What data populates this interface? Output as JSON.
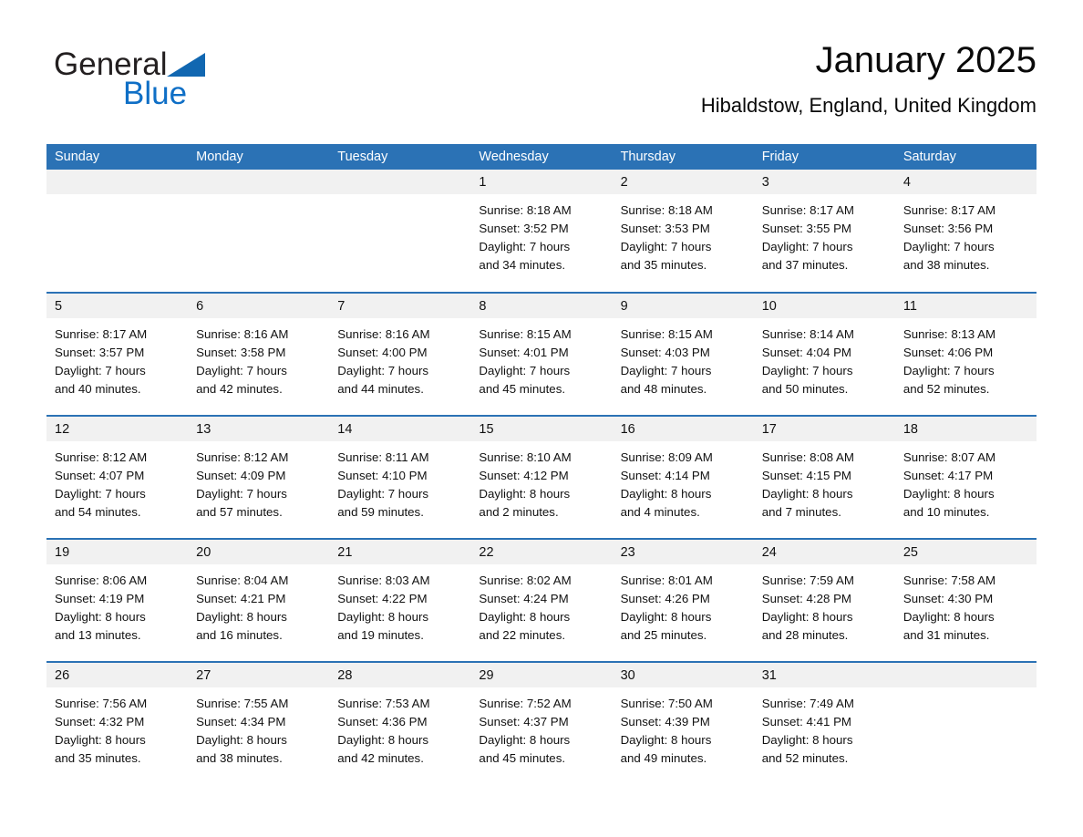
{
  "brand": {
    "name_part1": "General",
    "name_part2": "Blue",
    "flag_icon": "triangle-flag-icon",
    "accent_color": "#0f6fc6"
  },
  "header": {
    "title": "January 2025",
    "location": "Hibaldstow, England, United Kingdom"
  },
  "theme": {
    "header_blue": "#2b72b5",
    "daynum_gray": "#f1f1f1",
    "rule_blue": "#2b72b5"
  },
  "calendar": {
    "weekday_headers": [
      "Sunday",
      "Monday",
      "Tuesday",
      "Wednesday",
      "Thursday",
      "Friday",
      "Saturday"
    ],
    "weeks": [
      [
        {
          "day": "",
          "lines": []
        },
        {
          "day": "",
          "lines": []
        },
        {
          "day": "",
          "lines": []
        },
        {
          "day": "1",
          "lines": [
            "Sunrise: 8:18 AM",
            "Sunset: 3:52 PM",
            "Daylight: 7 hours",
            "and 34 minutes."
          ]
        },
        {
          "day": "2",
          "lines": [
            "Sunrise: 8:18 AM",
            "Sunset: 3:53 PM",
            "Daylight: 7 hours",
            "and 35 minutes."
          ]
        },
        {
          "day": "3",
          "lines": [
            "Sunrise: 8:17 AM",
            "Sunset: 3:55 PM",
            "Daylight: 7 hours",
            "and 37 minutes."
          ]
        },
        {
          "day": "4",
          "lines": [
            "Sunrise: 8:17 AM",
            "Sunset: 3:56 PM",
            "Daylight: 7 hours",
            "and 38 minutes."
          ]
        }
      ],
      [
        {
          "day": "5",
          "lines": [
            "Sunrise: 8:17 AM",
            "Sunset: 3:57 PM",
            "Daylight: 7 hours",
            "and 40 minutes."
          ]
        },
        {
          "day": "6",
          "lines": [
            "Sunrise: 8:16 AM",
            "Sunset: 3:58 PM",
            "Daylight: 7 hours",
            "and 42 minutes."
          ]
        },
        {
          "day": "7",
          "lines": [
            "Sunrise: 8:16 AM",
            "Sunset: 4:00 PM",
            "Daylight: 7 hours",
            "and 44 minutes."
          ]
        },
        {
          "day": "8",
          "lines": [
            "Sunrise: 8:15 AM",
            "Sunset: 4:01 PM",
            "Daylight: 7 hours",
            "and 45 minutes."
          ]
        },
        {
          "day": "9",
          "lines": [
            "Sunrise: 8:15 AM",
            "Sunset: 4:03 PM",
            "Daylight: 7 hours",
            "and 48 minutes."
          ]
        },
        {
          "day": "10",
          "lines": [
            "Sunrise: 8:14 AM",
            "Sunset: 4:04 PM",
            "Daylight: 7 hours",
            "and 50 minutes."
          ]
        },
        {
          "day": "11",
          "lines": [
            "Sunrise: 8:13 AM",
            "Sunset: 4:06 PM",
            "Daylight: 7 hours",
            "and 52 minutes."
          ]
        }
      ],
      [
        {
          "day": "12",
          "lines": [
            "Sunrise: 8:12 AM",
            "Sunset: 4:07 PM",
            "Daylight: 7 hours",
            "and 54 minutes."
          ]
        },
        {
          "day": "13",
          "lines": [
            "Sunrise: 8:12 AM",
            "Sunset: 4:09 PM",
            "Daylight: 7 hours",
            "and 57 minutes."
          ]
        },
        {
          "day": "14",
          "lines": [
            "Sunrise: 8:11 AM",
            "Sunset: 4:10 PM",
            "Daylight: 7 hours",
            "and 59 minutes."
          ]
        },
        {
          "day": "15",
          "lines": [
            "Sunrise: 8:10 AM",
            "Sunset: 4:12 PM",
            "Daylight: 8 hours",
            "and 2 minutes."
          ]
        },
        {
          "day": "16",
          "lines": [
            "Sunrise: 8:09 AM",
            "Sunset: 4:14 PM",
            "Daylight: 8 hours",
            "and 4 minutes."
          ]
        },
        {
          "day": "17",
          "lines": [
            "Sunrise: 8:08 AM",
            "Sunset: 4:15 PM",
            "Daylight: 8 hours",
            "and 7 minutes."
          ]
        },
        {
          "day": "18",
          "lines": [
            "Sunrise: 8:07 AM",
            "Sunset: 4:17 PM",
            "Daylight: 8 hours",
            "and 10 minutes."
          ]
        }
      ],
      [
        {
          "day": "19",
          "lines": [
            "Sunrise: 8:06 AM",
            "Sunset: 4:19 PM",
            "Daylight: 8 hours",
            "and 13 minutes."
          ]
        },
        {
          "day": "20",
          "lines": [
            "Sunrise: 8:04 AM",
            "Sunset: 4:21 PM",
            "Daylight: 8 hours",
            "and 16 minutes."
          ]
        },
        {
          "day": "21",
          "lines": [
            "Sunrise: 8:03 AM",
            "Sunset: 4:22 PM",
            "Daylight: 8 hours",
            "and 19 minutes."
          ]
        },
        {
          "day": "22",
          "lines": [
            "Sunrise: 8:02 AM",
            "Sunset: 4:24 PM",
            "Daylight: 8 hours",
            "and 22 minutes."
          ]
        },
        {
          "day": "23",
          "lines": [
            "Sunrise: 8:01 AM",
            "Sunset: 4:26 PM",
            "Daylight: 8 hours",
            "and 25 minutes."
          ]
        },
        {
          "day": "24",
          "lines": [
            "Sunrise: 7:59 AM",
            "Sunset: 4:28 PM",
            "Daylight: 8 hours",
            "and 28 minutes."
          ]
        },
        {
          "day": "25",
          "lines": [
            "Sunrise: 7:58 AM",
            "Sunset: 4:30 PM",
            "Daylight: 8 hours",
            "and 31 minutes."
          ]
        }
      ],
      [
        {
          "day": "26",
          "lines": [
            "Sunrise: 7:56 AM",
            "Sunset: 4:32 PM",
            "Daylight: 8 hours",
            "and 35 minutes."
          ]
        },
        {
          "day": "27",
          "lines": [
            "Sunrise: 7:55 AM",
            "Sunset: 4:34 PM",
            "Daylight: 8 hours",
            "and 38 minutes."
          ]
        },
        {
          "day": "28",
          "lines": [
            "Sunrise: 7:53 AM",
            "Sunset: 4:36 PM",
            "Daylight: 8 hours",
            "and 42 minutes."
          ]
        },
        {
          "day": "29",
          "lines": [
            "Sunrise: 7:52 AM",
            "Sunset: 4:37 PM",
            "Daylight: 8 hours",
            "and 45 minutes."
          ]
        },
        {
          "day": "30",
          "lines": [
            "Sunrise: 7:50 AM",
            "Sunset: 4:39 PM",
            "Daylight: 8 hours",
            "and 49 minutes."
          ]
        },
        {
          "day": "31",
          "lines": [
            "Sunrise: 7:49 AM",
            "Sunset: 4:41 PM",
            "Daylight: 8 hours",
            "and 52 minutes."
          ]
        },
        {
          "day": "",
          "lines": []
        }
      ]
    ]
  }
}
